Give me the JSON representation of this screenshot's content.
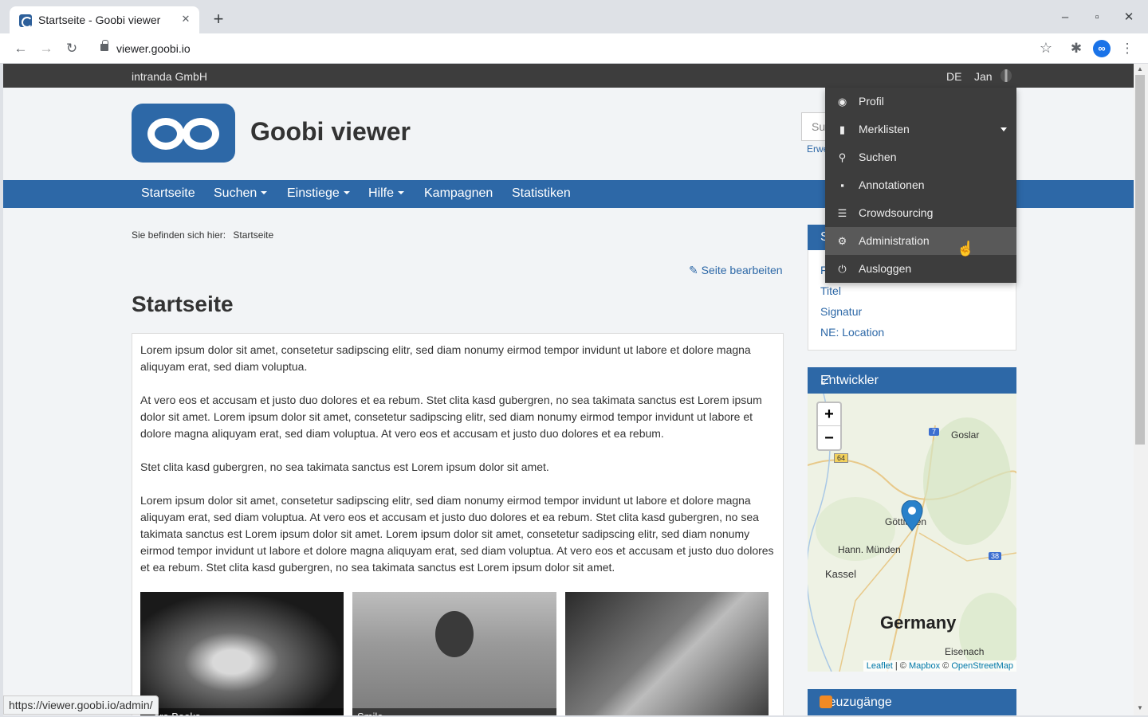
{
  "browser": {
    "tab_title": "Startseite - Goobi viewer",
    "url": "viewer.goobi.io",
    "status_url": "https://viewer.goobi.io/admin/"
  },
  "topbar": {
    "org": "intranda GmbH",
    "language": "DE",
    "user": "Jan"
  },
  "header": {
    "site_title": "Goobi viewer",
    "search_placeholder": "Su",
    "advanced_search": "Erwe"
  },
  "nav": {
    "items": [
      {
        "label": "Startseite"
      },
      {
        "label": "Suchen"
      },
      {
        "label": "Einstiege"
      },
      {
        "label": "Hilfe"
      },
      {
        "label": "Kampagnen"
      },
      {
        "label": "Statistiken"
      }
    ]
  },
  "breadcrumb": {
    "prefix": "Sie befinden sich hier:",
    "current": "Startseite"
  },
  "main": {
    "edit_link": "Seite bearbeiten",
    "title": "Startseite",
    "paragraphs": [
      "Lorem ipsum dolor sit amet, consetetur sadipscing elitr, sed diam nonumy eirmod tempor invidunt ut labore et dolore magna aliquyam erat, sed diam voluptua.",
      "At vero eos et accusam et justo duo dolores et ea rebum. Stet clita kasd gubergren, no sea takimata sanctus est Lorem ipsum dolor sit amet. Lorem ipsum dolor sit amet, consetetur sadipscing elitr, sed diam nonumy eirmod tempor invidunt ut labore et dolore magna aliquyam erat, sed diam voluptua. At vero eos et accusam et justo duo dolores et ea rebum.",
      "Stet clita kasd gubergren, no sea takimata sanctus est Lorem ipsum dolor sit amet.",
      "Lorem ipsum dolor sit amet, consetetur sadipscing elitr, sed diam nonumy eirmod tempor invidunt ut labore et dolore magna aliquyam erat, sed diam voluptua. At vero eos et accusam et justo duo dolores et ea rebum. Stet clita kasd gubergren, no sea takimata sanctus est Lorem ipsum dolor sit amet. Lorem ipsum dolor sit amet, consetetur sadipscing elitr, sed diam nonumy eirmod tempor invidunt ut labore et dolore magna aliquyam erat, sed diam voluptua. At vero eos et accusam et justo duo dolores et ea rebum. Stet clita kasd gubergren, no sea takimata sanctus est Lorem ipsum dolor sit amet."
    ],
    "thumbnails": [
      {
        "caption": "...ore Books"
      },
      {
        "caption": "Smile"
      },
      {
        "caption": ""
      }
    ]
  },
  "sidebar": {
    "widget_links": [
      "F",
      "Titel",
      "Signatur",
      "NE: Location"
    ],
    "widget_head": "S",
    "map": {
      "title": "Entwickler",
      "zoom_in": "+",
      "zoom_out": "−",
      "labels": {
        "goslar": "Goslar",
        "goettingen": "Göttingen",
        "hann_muenden": "Hann. Münden",
        "kassel": "Kassel",
        "germany": "Germany",
        "eisenach": "Eisenach",
        "road_7": "7",
        "road_64": "64",
        "road_38": "38"
      },
      "attribution": {
        "leaflet": "Leaflet",
        "sep": "| ©",
        "mapbox": "Mapbox",
        "copy": "©",
        "osm": "OpenStreetMap"
      }
    },
    "new_widget": "Neuzugänge"
  },
  "user_menu": {
    "items": [
      {
        "label": "Profil",
        "icon": "user-circle-icon"
      },
      {
        "label": "Merklisten",
        "icon": "bookmark-icon"
      },
      {
        "label": "Suchen",
        "icon": "search-icon"
      },
      {
        "label": "Annotationen",
        "icon": "sticky-note-icon"
      },
      {
        "label": "Crowdsourcing",
        "icon": "list-icon"
      },
      {
        "label": "Administration",
        "icon": "cogs-icon"
      },
      {
        "label": "Ausloggen",
        "icon": "power-icon"
      }
    ]
  },
  "colors": {
    "primary": "#2d68a7",
    "topbar": "#3d3d3d",
    "menu_active": "#595959"
  }
}
